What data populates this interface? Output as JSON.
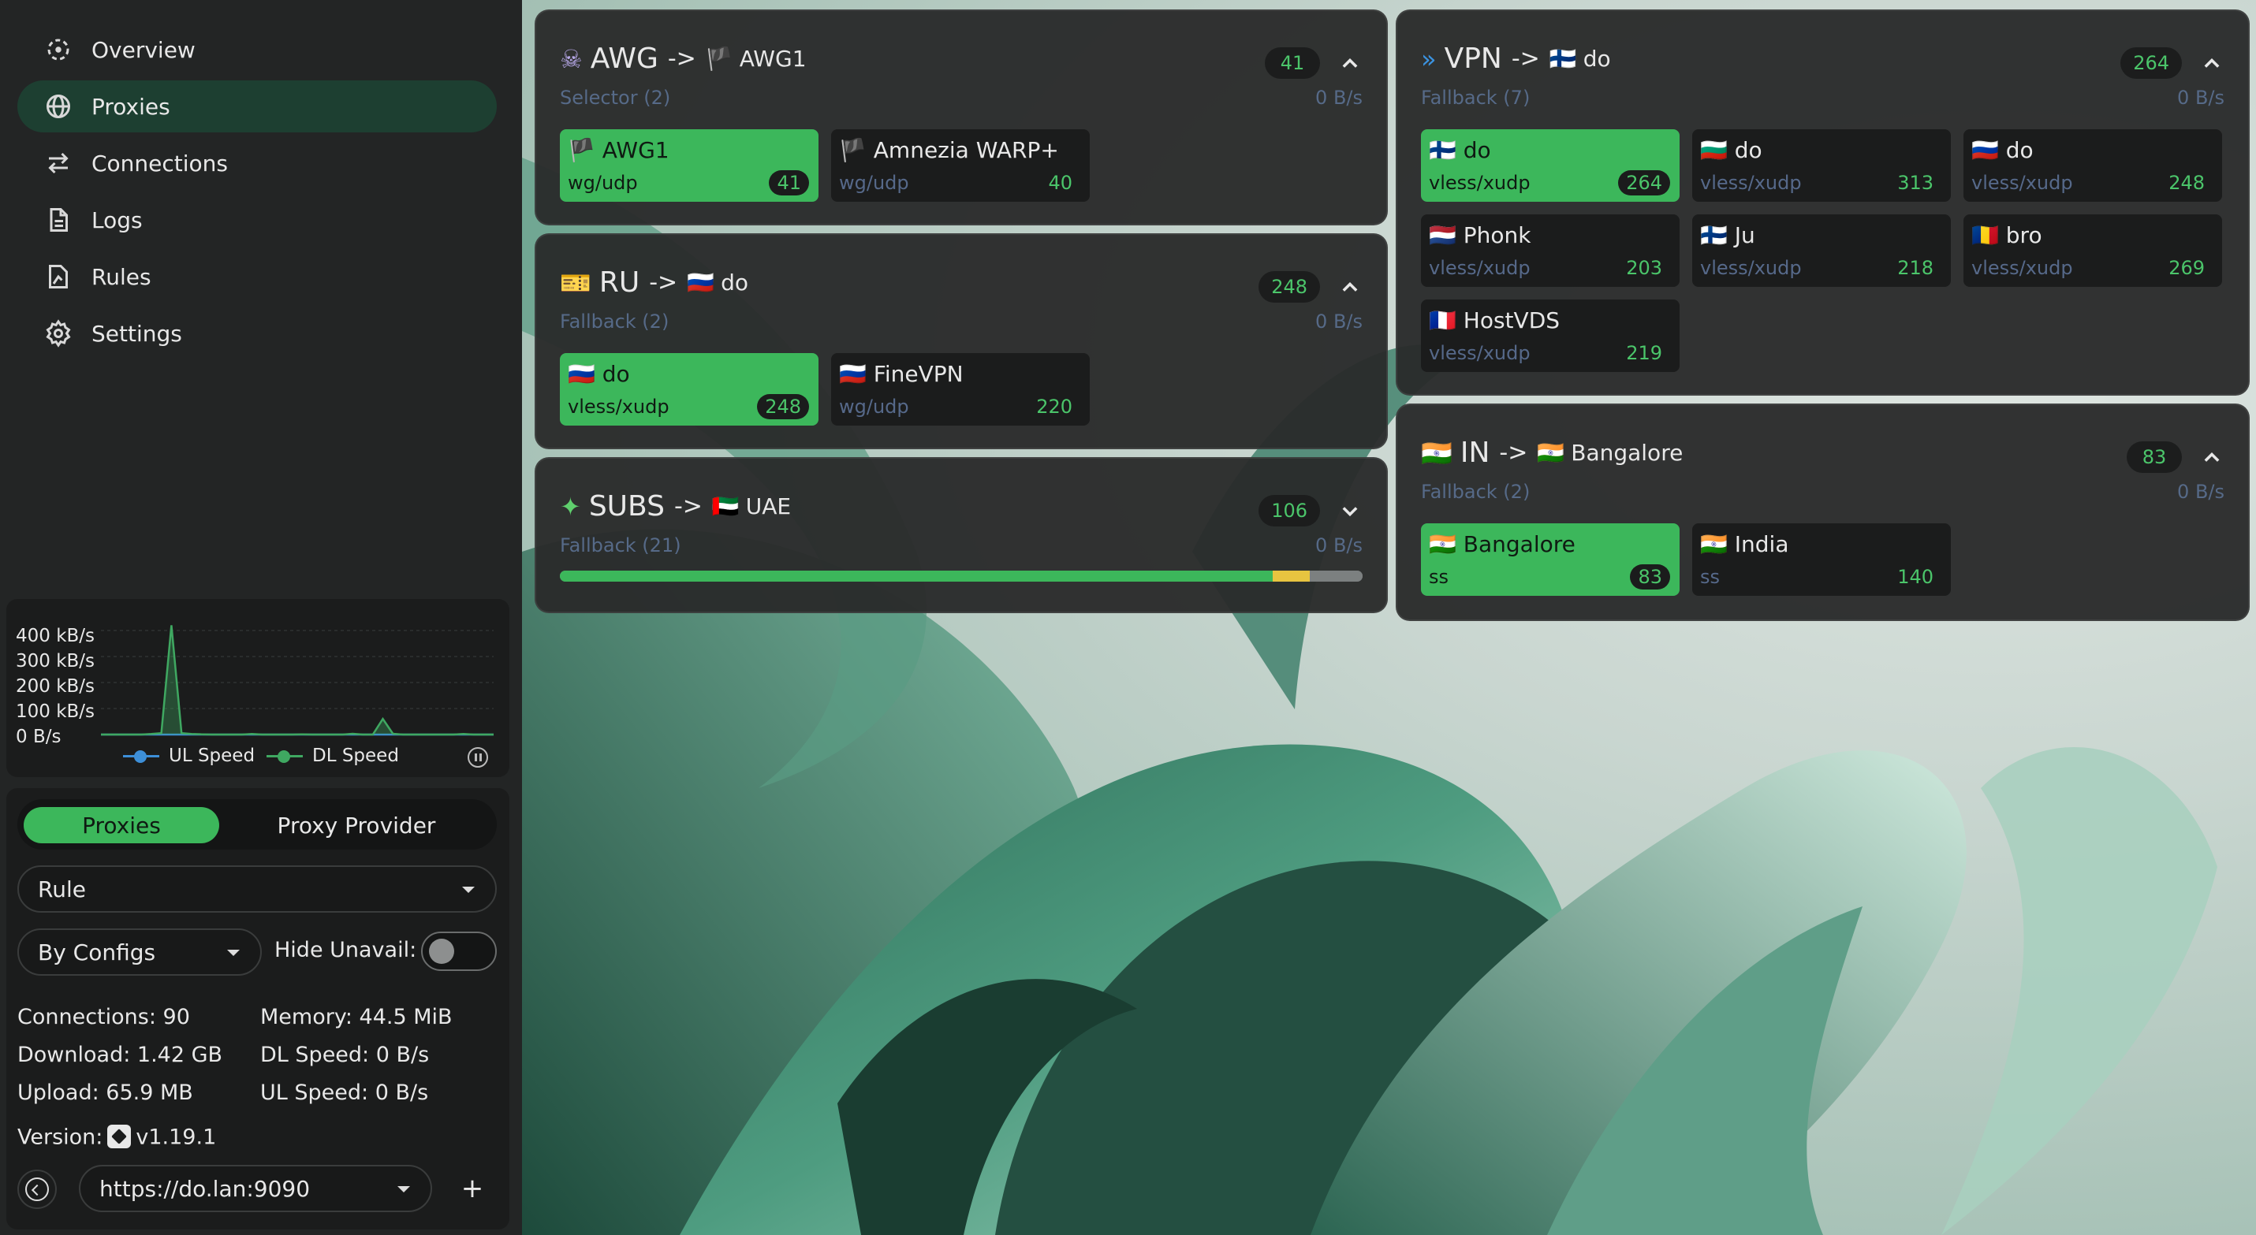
{
  "nav": {
    "items": [
      {
        "label": "Overview",
        "icon": "overview-icon"
      },
      {
        "label": "Proxies",
        "icon": "globe-icon",
        "active": true
      },
      {
        "label": "Connections",
        "icon": "arrows-icon"
      },
      {
        "label": "Logs",
        "icon": "document-icon"
      },
      {
        "label": "Rules",
        "icon": "rules-icon"
      },
      {
        "label": "Settings",
        "icon": "gear-icon"
      }
    ]
  },
  "traffic": {
    "y_ticks": [
      "400 kB/s",
      "300 kB/s",
      "200 kB/s",
      "100 kB/s",
      "0 B/s"
    ],
    "legend_ul": "UL Speed",
    "legend_dl": "DL Speed",
    "colors": {
      "ul": "#3d8fd8",
      "dl": "#3fa861"
    }
  },
  "chart_data": {
    "type": "line",
    "ylabel": "",
    "ylim": [
      0,
      400
    ],
    "y_unit": "kB/s",
    "series": [
      {
        "name": "UL Speed",
        "values": [
          0,
          0,
          0,
          0,
          0,
          0,
          0,
          0,
          0,
          0,
          0,
          0,
          0,
          0,
          0,
          0,
          0,
          0,
          0,
          0,
          0,
          0,
          0,
          0,
          0,
          0,
          0,
          0,
          0,
          0,
          0,
          0,
          0,
          0,
          0,
          0,
          0,
          0,
          0,
          0
        ]
      },
      {
        "name": "DL Speed",
        "values": [
          0,
          0,
          0,
          0,
          0,
          2,
          5,
          460,
          5,
          2,
          1,
          0,
          0,
          0,
          0,
          2,
          0,
          0,
          0,
          0,
          1,
          0,
          0,
          0,
          0,
          3,
          0,
          0,
          60,
          3,
          0,
          0,
          0,
          0,
          0,
          0,
          2,
          0,
          0,
          0
        ]
      }
    ]
  },
  "panel": {
    "tab_proxies": "Proxies",
    "tab_provider": "Proxy Provider",
    "mode_value": "Rule",
    "sort_value": "By Configs",
    "hide_unavail_label": "Hide Unavail:",
    "connections": "Connections: 90",
    "memory": "Memory: 44.5 MiB",
    "download": "Download: 1.42 GB",
    "dl_speed": "DL Speed: 0 B/s",
    "upload": "Upload: 65.9 MB",
    "ul_speed": "UL Speed: 0 B/s",
    "version_label": "Version:",
    "version_value": "v1.19.1",
    "backend_url": "https://do.lan:9090",
    "add_label": "+"
  },
  "groups": {
    "awg": {
      "emoji": "☠",
      "name": "AWG",
      "arrow": "->",
      "now_flag": "🏴",
      "now": "AWG1",
      "type": "Selector (2)",
      "count": "41",
      "rate": "0 B/s",
      "proxies": [
        {
          "flag": "🏴",
          "name": "AWG1",
          "type": "wg/udp",
          "latency": "41",
          "selected": true
        },
        {
          "flag": "🏴",
          "name": "Amnezia WARP+",
          "type": "wg/udp",
          "latency": "40"
        }
      ]
    },
    "ru": {
      "emoji": "🎫",
      "name": "RU",
      "arrow": "->",
      "now_flag": "🇷🇺",
      "now": "do",
      "type": "Fallback (2)",
      "count": "248",
      "rate": "0 B/s",
      "proxies": [
        {
          "flag": "🇷🇺",
          "name": "do",
          "type": "vless/xudp",
          "latency": "248",
          "selected": true
        },
        {
          "flag": "🇷🇺",
          "name": "FineVPN",
          "type": "wg/udp",
          "latency": "220"
        }
      ]
    },
    "subs": {
      "emoji": "✦",
      "name": "SUBS",
      "arrow": "->",
      "now_flag": "🇦🇪",
      "now": "UAE",
      "type": "Fallback (21)",
      "count": "106",
      "rate": "0 B/s",
      "latency_bar": [
        {
          "fraction": 0.888,
          "color": "#3cb75b"
        },
        {
          "fraction": 0.046,
          "color": "#e7c440"
        },
        {
          "fraction": 0.066,
          "color": "#7c8080"
        }
      ]
    },
    "vpn": {
      "emoji": "»",
      "name": "VPN",
      "arrow": "->",
      "now_flag": "🇫🇮",
      "now": "do",
      "type": "Fallback (7)",
      "count": "264",
      "rate": "0 B/s",
      "proxies": [
        {
          "flag": "🇫🇮",
          "name": "do",
          "type": "vless/xudp",
          "latency": "264",
          "selected": true
        },
        {
          "flag": "🇧🇬",
          "name": "do",
          "type": "vless/xudp",
          "latency": "313"
        },
        {
          "flag": "🇷🇺",
          "name": "do",
          "type": "vless/xudp",
          "latency": "248"
        },
        {
          "flag": "🇳🇱",
          "name": "Phonk",
          "type": "vless/xudp",
          "latency": "203"
        },
        {
          "flag": "🇫🇮",
          "name": "Ju",
          "type": "vless/xudp",
          "latency": "218"
        },
        {
          "flag": "🇷🇴",
          "name": "bro",
          "type": "vless/xudp",
          "latency": "269"
        },
        {
          "flag": "🇫🇷",
          "name": "HostVDS",
          "type": "vless/xudp",
          "latency": "219"
        }
      ]
    },
    "in": {
      "emoji": "🇮🇳",
      "name": "IN",
      "arrow": "->",
      "now_flag": "🇮🇳",
      "now": "Bangalore",
      "type": "Fallback (2)",
      "count": "83",
      "rate": "0 B/s",
      "proxies": [
        {
          "flag": "🇮🇳",
          "name": "Bangalore",
          "type": "ss",
          "latency": "83",
          "selected": true
        },
        {
          "flag": "🇮🇳",
          "name": "India",
          "type": "ss",
          "latency": "140"
        }
      ]
    }
  }
}
